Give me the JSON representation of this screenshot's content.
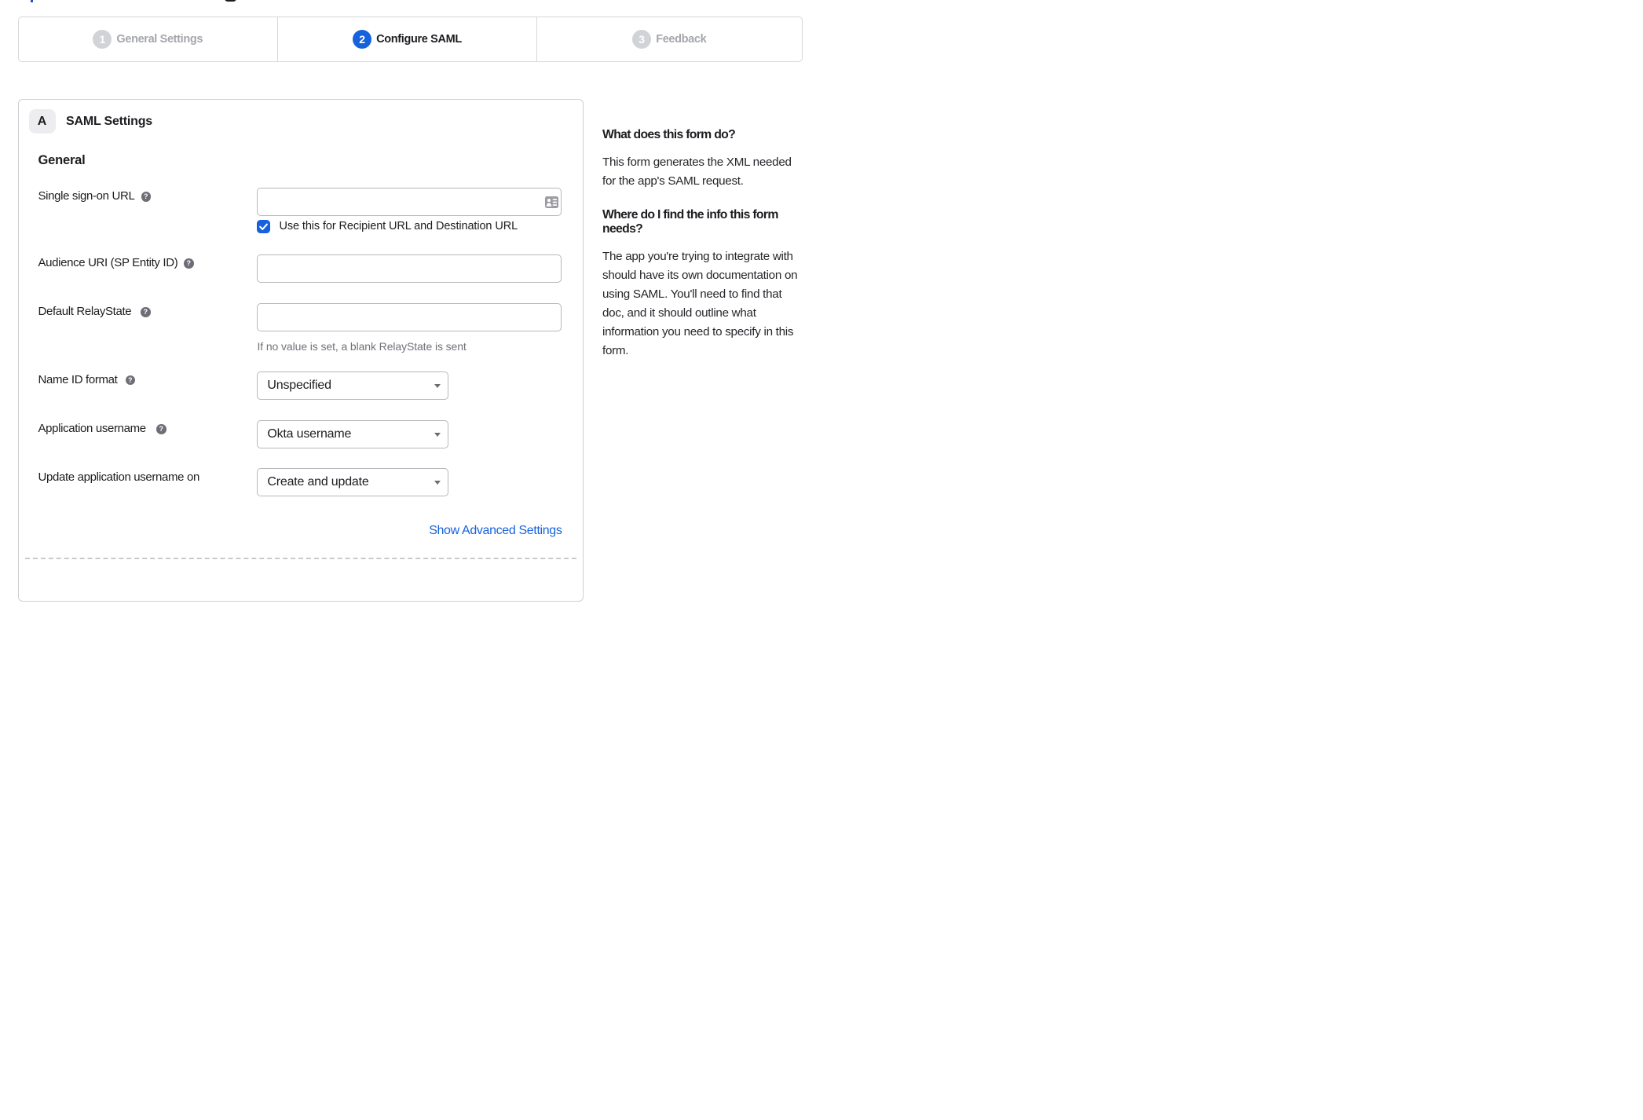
{
  "colors": {
    "accent_blue": "#1662dd",
    "text_dark": "#1d1d21",
    "inactive_gray": "#a4a6ab"
  },
  "stepper": {
    "steps": [
      {
        "number": "1",
        "label": "General Settings",
        "state": "inactive"
      },
      {
        "number": "2",
        "label": "Configure SAML",
        "state": "active"
      },
      {
        "number": "3",
        "label": "Feedback",
        "state": "inactive"
      }
    ]
  },
  "panel": {
    "section_marker": "A",
    "section_title": "SAML Settings",
    "group_heading": "General",
    "fields": [
      {
        "label": "Single sign-on URL",
        "type": "text",
        "value": "",
        "checkbox": {
          "checked": true,
          "label": "Use this for Recipient URL and Destination URL"
        }
      },
      {
        "label": "Audience URI (SP Entity ID)",
        "type": "text",
        "value": ""
      },
      {
        "label": "Default RelayState",
        "type": "text",
        "value": "",
        "hint": "If no value is set, a blank RelayState is sent"
      },
      {
        "label": "Name ID format",
        "type": "select",
        "value": "Unspecified"
      },
      {
        "label": "Application username",
        "type": "select",
        "value": "Okta username"
      },
      {
        "label": "Update application username on",
        "type": "select",
        "value": "Create and update"
      }
    ],
    "advanced_link": "Show Advanced Settings"
  },
  "sidebar": {
    "sections": [
      {
        "heading": "What does this form do?",
        "body": "This form generates the XML needed for the app's SAML request."
      },
      {
        "heading": "Where do I find the info this form needs?",
        "body": "The app you're trying to integrate with should have its own documentation on using SAML. You'll need to find that doc, and it should outline what information you need to specify in this form."
      }
    ]
  }
}
